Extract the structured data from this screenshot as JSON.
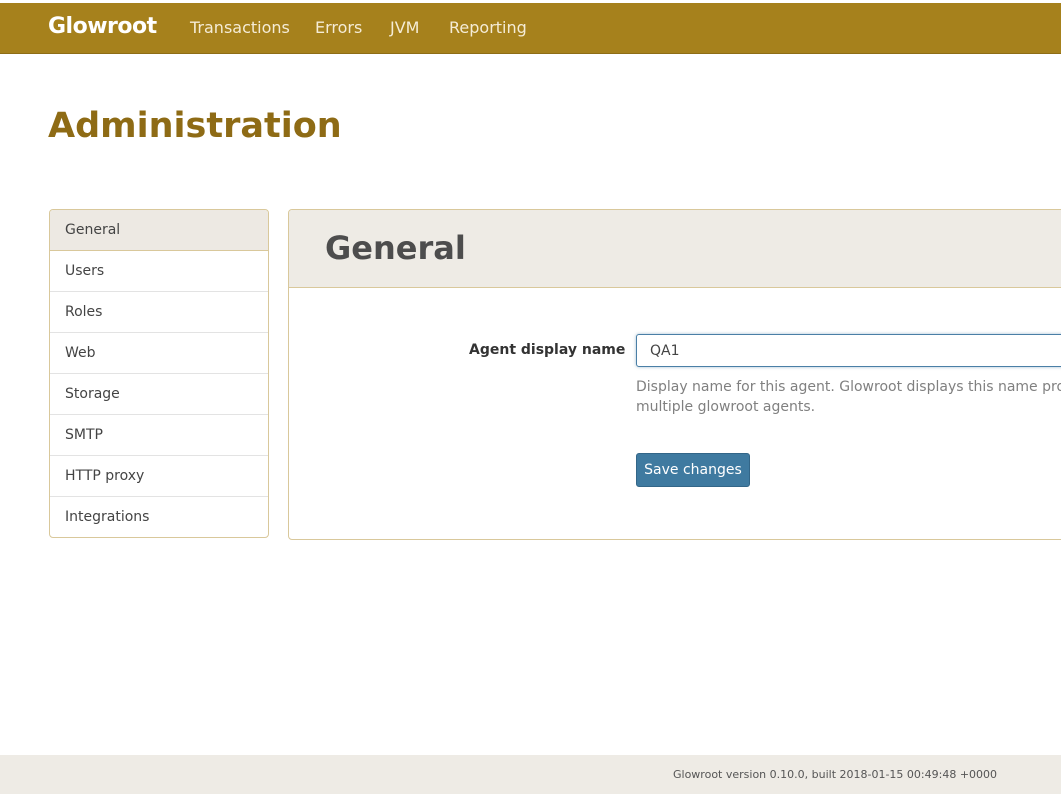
{
  "nav": {
    "brand": "Glowroot",
    "links": [
      "Transactions",
      "Errors",
      "JVM",
      "Reporting"
    ]
  },
  "page_title": "Administration",
  "sidebar": {
    "items": [
      "General",
      "Users",
      "Roles",
      "Web",
      "Storage",
      "SMTP",
      "HTTP proxy",
      "Integrations"
    ],
    "active": "General"
  },
  "panel": {
    "title": "General",
    "field_label": "Agent display name",
    "field_value": "QA1",
    "help_line1": "Display name for this agent. Glowroot displays this name prominently",
    "help_line2": "multiple glowroot agents.",
    "save_label": "Save changes"
  },
  "footer": {
    "text": "Glowroot version 0.10.0, built 2018-01-15 00:49:48 +0000"
  },
  "colors": {
    "topbar": "#a6811c",
    "title": "#8e6b15",
    "button": "#3f7aa0",
    "panel_head": "#eeebe5"
  }
}
